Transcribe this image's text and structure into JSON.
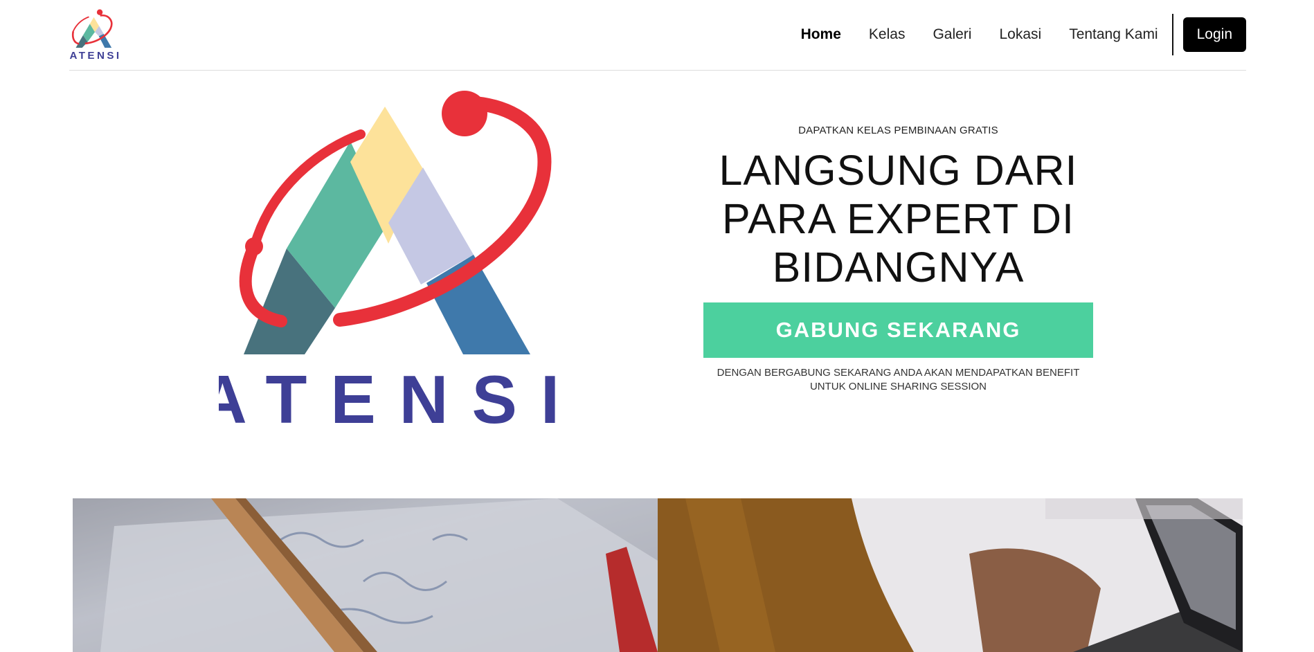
{
  "header": {
    "logo_text": "ATENSI",
    "nav": [
      {
        "label": "Home",
        "active": true
      },
      {
        "label": "Kelas",
        "active": false
      },
      {
        "label": "Galeri",
        "active": false
      },
      {
        "label": "Lokasi",
        "active": false
      },
      {
        "label": "Tentang Kami",
        "active": false
      }
    ],
    "login_label": "Login"
  },
  "hero": {
    "logo_text": "ATENSI",
    "eyebrow": "DAPATKAN KELAS PEMBINAAN GRATIS",
    "headline": "LANGSUNG DARI PARA EXPERT DI BIDANGNYA",
    "cta_label": "GABUNG SEKARANG",
    "cta_note": "DENGAN BERGABUNG SEKARANG ANDA AKAN MENDAPATKAN BENEFIT UNTUK ONLINE SHARING SESSION"
  },
  "colors": {
    "accent": "#4cd09e",
    "logo_red": "#e8313a",
    "logo_purple": "#3e3f96",
    "logo_yellow": "#fde29a",
    "logo_green": "#5cb8a0",
    "logo_lavender": "#c5c8e4",
    "logo_teal": "#48727d",
    "logo_blue": "#3f79ab"
  },
  "gallery": [
    {
      "subject": "sketchbook-with-pencil"
    },
    {
      "subject": "hands-typing-on-laptop"
    }
  ]
}
